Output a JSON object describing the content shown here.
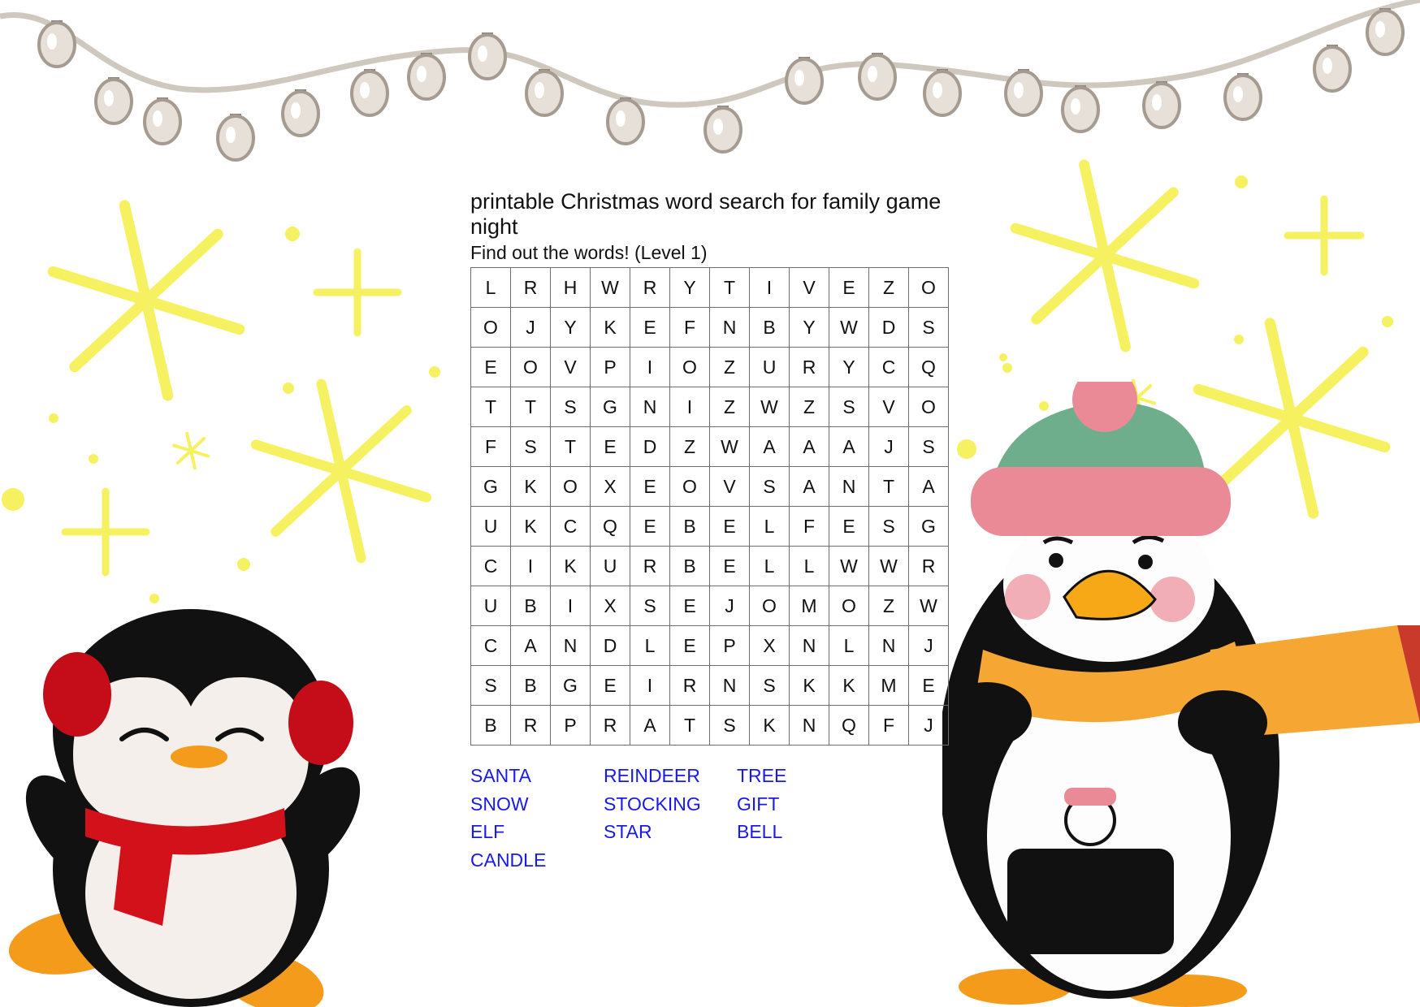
{
  "puzzle": {
    "title": "printable Christmas word search for family game night",
    "subtitle": "Find out the words! (Level 1)",
    "grid": [
      [
        "L",
        "R",
        "H",
        "W",
        "R",
        "Y",
        "T",
        "I",
        "V",
        "E",
        "Z",
        "O"
      ],
      [
        "O",
        "J",
        "Y",
        "K",
        "E",
        "F",
        "N",
        "B",
        "Y",
        "W",
        "D",
        "S"
      ],
      [
        "E",
        "O",
        "V",
        "P",
        "I",
        "O",
        "Z",
        "U",
        "R",
        "Y",
        "C",
        "Q"
      ],
      [
        "T",
        "T",
        "S",
        "G",
        "N",
        "I",
        "Z",
        "W",
        "Z",
        "S",
        "V",
        "O"
      ],
      [
        "F",
        "S",
        "T",
        "E",
        "D",
        "Z",
        "W",
        "A",
        "A",
        "A",
        "J",
        "S"
      ],
      [
        "G",
        "K",
        "O",
        "X",
        "E",
        "O",
        "V",
        "S",
        "A",
        "N",
        "T",
        "A"
      ],
      [
        "U",
        "K",
        "C",
        "Q",
        "E",
        "B",
        "E",
        "L",
        "F",
        "E",
        "S",
        "G"
      ],
      [
        "C",
        "I",
        "K",
        "U",
        "R",
        "B",
        "E",
        "L",
        "L",
        "W",
        "W",
        "R"
      ],
      [
        "U",
        "B",
        "I",
        "X",
        "S",
        "E",
        "J",
        "O",
        "M",
        "O",
        "Z",
        "W"
      ],
      [
        "C",
        "A",
        "N",
        "D",
        "L",
        "E",
        "P",
        "X",
        "N",
        "L",
        "N",
        "J"
      ],
      [
        "S",
        "B",
        "G",
        "E",
        "I",
        "R",
        "N",
        "S",
        "K",
        "K",
        "M",
        "E"
      ],
      [
        "B",
        "R",
        "P",
        "R",
        "A",
        "T",
        "S",
        "K",
        "N",
        "Q",
        "F",
        "J"
      ]
    ],
    "words": [
      "SANTA",
      "REINDEER",
      "TREE",
      "SNOW",
      "STOCKING",
      "GIFT",
      "ELF",
      "STAR",
      "BELL",
      "CANDLE"
    ]
  },
  "colors": {
    "word_text": "#1a1ae6",
    "sparkle": "#f6f160",
    "grid_border": "#6d6d6d"
  },
  "icons": [
    "string-lights-garland",
    "sparkle-star-icon",
    "penguin-earmuffs-illustration",
    "penguin-hat-scarf-illustration"
  ]
}
